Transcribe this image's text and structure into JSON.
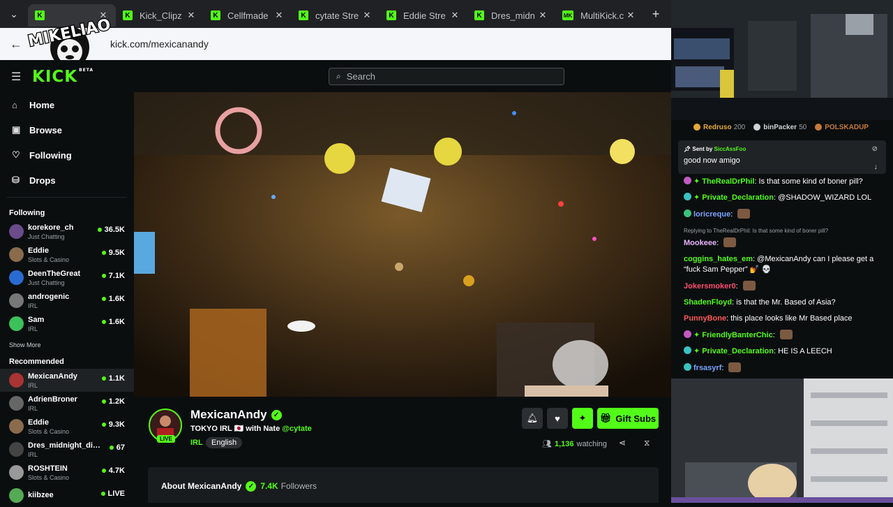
{
  "tabs": [
    {
      "label": "",
      "active": true
    },
    {
      "label": "Kick_Clipz"
    },
    {
      "label": "Cellfmade"
    },
    {
      "label": "cytate Stre"
    },
    {
      "label": "Eddie Stre"
    },
    {
      "label": "Dres_midn"
    },
    {
      "label": "MultiKick.c"
    }
  ],
  "address": {
    "url": "kick.com/mexicanandy"
  },
  "overlay_logo": {
    "text": "MIKELIAO"
  },
  "header": {
    "logo": "KICK",
    "logo_sup": "BETA",
    "search_placeholder": "Search"
  },
  "nav": [
    {
      "label": "Home",
      "icon": "home-icon"
    },
    {
      "label": "Browse",
      "icon": "browse-icon"
    },
    {
      "label": "Following",
      "icon": "heart-icon"
    },
    {
      "label": "Drops",
      "icon": "drops-icon"
    }
  ],
  "following": {
    "title": "Following",
    "channels": [
      {
        "name": "korekore_ch",
        "category": "Just Chatting",
        "viewers": "36.5K",
        "color": "#6b4c8a"
      },
      {
        "name": "Eddie",
        "category": "Slots & Casino",
        "viewers": "9.5K",
        "color": "#8a6b4c"
      },
      {
        "name": "DeenTheGreat",
        "category": "Just Chatting",
        "viewers": "7.1K",
        "color": "#2a6bd1"
      },
      {
        "name": "androgenic",
        "category": "IRL",
        "viewers": "1.6K",
        "color": "#777"
      },
      {
        "name": "Sam",
        "category": "IRL",
        "viewers": "1.6K",
        "color": "#3cc25a"
      }
    ],
    "show_more": "Show More"
  },
  "recommended": {
    "title": "Recommended",
    "channels": [
      {
        "name": "MexicanAndy",
        "category": "IRL",
        "viewers": "1.1K",
        "color": "#a33",
        "active": true
      },
      {
        "name": "AdrienBroner",
        "category": "IRL",
        "viewers": "1.2K",
        "color": "#666"
      },
      {
        "name": "Eddie",
        "category": "Slots & Casino",
        "viewers": "9.3K",
        "color": "#8a6b4c"
      },
      {
        "name": "Dres_midnight_diner",
        "category": "IRL",
        "viewers": "67",
        "color": "#444"
      },
      {
        "name": "ROSHTEIN",
        "category": "Slots & Casino",
        "viewers": "4.7K",
        "color": "#999"
      },
      {
        "name": "kiibzee",
        "category": "",
        "viewers": "LIVE",
        "color": "#5a5"
      }
    ]
  },
  "channel": {
    "name": "MexicanAndy",
    "live": "LIVE",
    "title_prefix": "TOKYO IRL 🇯🇵 with Nate",
    "mention": "@cytate",
    "category": "IRL",
    "language": "English",
    "gift_label": "Gift Subs",
    "watching_count": "1,136",
    "watching_label": "watching",
    "about_label": "About MexicanAndy",
    "followers_count": "7.4K",
    "followers_label": "Followers"
  },
  "chat": {
    "leaderboard": [
      {
        "name": "Redruso",
        "count": "200",
        "color": "#e5a93a"
      },
      {
        "name": "binPacker",
        "count": "50",
        "color": "#cfd3d6"
      },
      {
        "name": "POLSKADUP",
        "count": "",
        "color": "#c57a3a"
      }
    ],
    "pinned": {
      "sent_by": "Sent by",
      "user": "SiccAssFoo",
      "message": "good now amigo"
    },
    "messages": [
      {
        "user": "TheRealDrPhil",
        "color": "#53fc18",
        "badge": "#c25ac2",
        "star": true,
        "text": "Is that some kind of boner pill?"
      },
      {
        "user": "Private_Declaration",
        "color": "#53fc18",
        "badge": "#3ac2c2",
        "star": true,
        "text": "@SHADOW_WIZARD LOL"
      },
      {
        "user": "loricreque",
        "color": "#7aa3ff",
        "badge": "#3ac27a",
        "star": false,
        "text": "",
        "emote": true
      },
      {
        "user": "Mookeee",
        "color": "#e8b4ff",
        "reply": "Replying to TheRealDrPhil: Is that some kind of boner pill?",
        "text": "",
        "emote": true
      },
      {
        "user": "coggins_hates_em",
        "color": "#53fc18",
        "text": "@MexicanAndy can I please get a “fuck Sam Pepper” 💅 💀"
      },
      {
        "user": "Jokersmoker0",
        "color": "#ff4d6d",
        "text": "",
        "emote": true
      },
      {
        "user": "ShadenFloyd",
        "color": "#53fc18",
        "text": "is that the Mr. Based of Asia?"
      },
      {
        "user": "PunnyBone",
        "color": "#ff5a5a",
        "text": "this place looks like Mr Based place"
      },
      {
        "user": "FriendlyBanterChic",
        "color": "#53fc18",
        "badge": "#c25ac2",
        "star": true,
        "text": "",
        "emote": true
      },
      {
        "user": "Private_Declaration",
        "color": "#53fc18",
        "badge": "#3ac2c2",
        "star": true,
        "text": "HE IS A LEECH"
      },
      {
        "user": "frsasyrf",
        "color": "#7aa3ff",
        "badge": "#3ac2c2",
        "text": "",
        "emote": true
      }
    ]
  },
  "colors": {
    "accent": "#53fc18",
    "bg": "#0b0e0f",
    "panel": "#191c1e"
  }
}
